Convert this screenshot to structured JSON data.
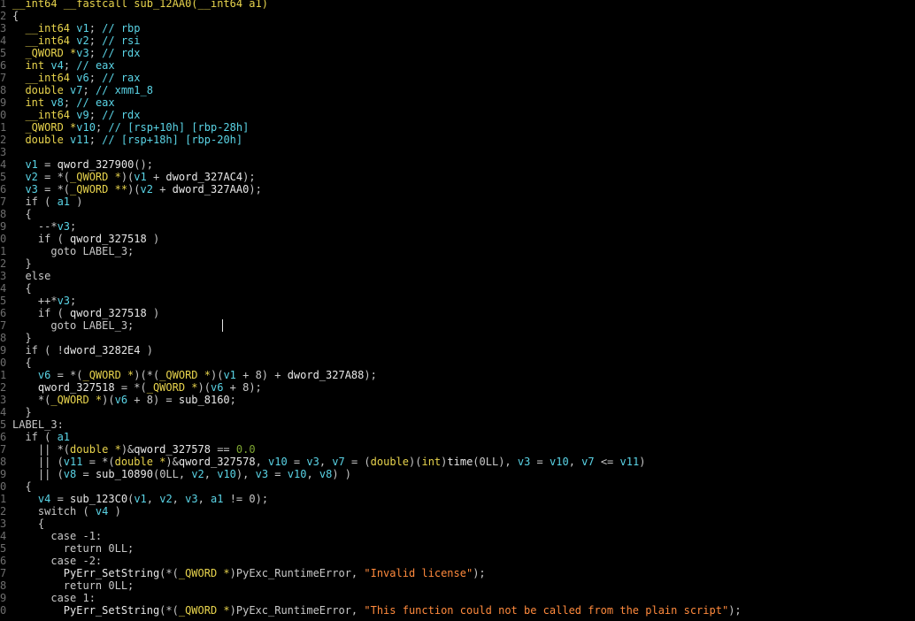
{
  "editor": {
    "lines": [
      {
        "n": "1",
        "toks": [
          {
            "t": "__int64 __fastcall sub_12AA0(__int64 a1)",
            "c": "t-type"
          }
        ]
      },
      {
        "n": "2",
        "toks": [
          {
            "t": "{",
            "c": "t-p"
          }
        ]
      },
      {
        "n": "3",
        "toks": [
          {
            "t": "  __int64 ",
            "c": "t-type"
          },
          {
            "t": "v1",
            "c": "t-var"
          },
          {
            "t": "; ",
            "c": "t-p"
          },
          {
            "t": "// rbp",
            "c": "t-cmt"
          }
        ]
      },
      {
        "n": "4",
        "toks": [
          {
            "t": "  __int64 ",
            "c": "t-type"
          },
          {
            "t": "v2",
            "c": "t-var"
          },
          {
            "t": "; ",
            "c": "t-p"
          },
          {
            "t": "// rsi",
            "c": "t-cmt"
          }
        ]
      },
      {
        "n": "5",
        "toks": [
          {
            "t": "  _QWORD *",
            "c": "t-type"
          },
          {
            "t": "v3",
            "c": "t-var"
          },
          {
            "t": "; ",
            "c": "t-p"
          },
          {
            "t": "// rdx",
            "c": "t-cmt"
          }
        ]
      },
      {
        "n": "6",
        "toks": [
          {
            "t": "  int ",
            "c": "t-type"
          },
          {
            "t": "v4",
            "c": "t-var"
          },
          {
            "t": "; ",
            "c": "t-p"
          },
          {
            "t": "// eax",
            "c": "t-cmt"
          }
        ]
      },
      {
        "n": "7",
        "toks": [
          {
            "t": "  __int64 ",
            "c": "t-type"
          },
          {
            "t": "v6",
            "c": "t-var"
          },
          {
            "t": "; ",
            "c": "t-p"
          },
          {
            "t": "// rax",
            "c": "t-cmt"
          }
        ]
      },
      {
        "n": "8",
        "toks": [
          {
            "t": "  double ",
            "c": "t-type"
          },
          {
            "t": "v7",
            "c": "t-var"
          },
          {
            "t": "; ",
            "c": "t-p"
          },
          {
            "t": "// xmm1_8",
            "c": "t-cmt"
          }
        ]
      },
      {
        "n": "9",
        "toks": [
          {
            "t": "  int ",
            "c": "t-type"
          },
          {
            "t": "v8",
            "c": "t-var"
          },
          {
            "t": "; ",
            "c": "t-p"
          },
          {
            "t": "// eax",
            "c": "t-cmt"
          }
        ]
      },
      {
        "n": "0",
        "toks": [
          {
            "t": "  __int64 ",
            "c": "t-type"
          },
          {
            "t": "v9",
            "c": "t-var"
          },
          {
            "t": "; ",
            "c": "t-p"
          },
          {
            "t": "// rdx",
            "c": "t-cmt"
          }
        ]
      },
      {
        "n": "1",
        "toks": [
          {
            "t": "  _QWORD *",
            "c": "t-type"
          },
          {
            "t": "v10",
            "c": "t-var"
          },
          {
            "t": "; ",
            "c": "t-p"
          },
          {
            "t": "// [rsp+10h] [rbp-28h]",
            "c": "t-cmt"
          }
        ]
      },
      {
        "n": "2",
        "toks": [
          {
            "t": "  double ",
            "c": "t-type"
          },
          {
            "t": "v11",
            "c": "t-var"
          },
          {
            "t": "; ",
            "c": "t-p"
          },
          {
            "t": "// [rsp+18h] [rbp-20h]",
            "c": "t-cmt"
          }
        ]
      },
      {
        "n": "3",
        "toks": []
      },
      {
        "n": "4",
        "toks": [
          {
            "t": "  v1",
            "c": "t-var"
          },
          {
            "t": " = ",
            "c": "t-p"
          },
          {
            "t": "qword_327900",
            "c": "t-fn"
          },
          {
            "t": "();",
            "c": "t-p"
          }
        ]
      },
      {
        "n": "5",
        "toks": [
          {
            "t": "  v2",
            "c": "t-var"
          },
          {
            "t": " = *(",
            "c": "t-p"
          },
          {
            "t": "_QWORD *",
            "c": "t-type"
          },
          {
            "t": ")(",
            "c": "t-p"
          },
          {
            "t": "v1",
            "c": "t-var"
          },
          {
            "t": " + ",
            "c": "t-p"
          },
          {
            "t": "dword_327AC4",
            "c": "t-fn"
          },
          {
            "t": ");",
            "c": "t-p"
          }
        ]
      },
      {
        "n": "6",
        "toks": [
          {
            "t": "  v3",
            "c": "t-var"
          },
          {
            "t": " = *(",
            "c": "t-p"
          },
          {
            "t": "_QWORD **",
            "c": "t-type"
          },
          {
            "t": ")(",
            "c": "t-p"
          },
          {
            "t": "v2",
            "c": "t-var"
          },
          {
            "t": " + ",
            "c": "t-p"
          },
          {
            "t": "dword_327AA0",
            "c": "t-fn"
          },
          {
            "t": ");",
            "c": "t-p"
          }
        ]
      },
      {
        "n": "7",
        "toks": [
          {
            "t": "  if ( ",
            "c": "t-kw"
          },
          {
            "t": "a1",
            "c": "t-var"
          },
          {
            "t": " )",
            "c": "t-p"
          }
        ]
      },
      {
        "n": "8",
        "toks": [
          {
            "t": "  {",
            "c": "t-p"
          }
        ]
      },
      {
        "n": "9",
        "toks": [
          {
            "t": "    --*",
            "c": "t-p"
          },
          {
            "t": "v3",
            "c": "t-var"
          },
          {
            "t": ";",
            "c": "t-p"
          }
        ]
      },
      {
        "n": "0",
        "toks": [
          {
            "t": "    if ( ",
            "c": "t-kw"
          },
          {
            "t": "qword_327518",
            "c": "t-fn"
          },
          {
            "t": " )",
            "c": "t-p"
          }
        ]
      },
      {
        "n": "1",
        "toks": [
          {
            "t": "      goto LABEL_3;",
            "c": "t-kw"
          }
        ]
      },
      {
        "n": "2",
        "toks": [
          {
            "t": "  }",
            "c": "t-p"
          }
        ]
      },
      {
        "n": "3",
        "toks": [
          {
            "t": "  else",
            "c": "t-kw"
          }
        ]
      },
      {
        "n": "4",
        "toks": [
          {
            "t": "  {",
            "c": "t-p"
          }
        ]
      },
      {
        "n": "5",
        "toks": [
          {
            "t": "    ++*",
            "c": "t-p"
          },
          {
            "t": "v3",
            "c": "t-var"
          },
          {
            "t": ";",
            "c": "t-p"
          }
        ]
      },
      {
        "n": "6",
        "toks": [
          {
            "t": "    if ( ",
            "c": "t-kw"
          },
          {
            "t": "qword_327518",
            "c": "t-fn"
          },
          {
            "t": " )",
            "c": "t-p"
          }
        ]
      },
      {
        "n": "7",
        "toks": [
          {
            "t": "      goto LABEL_3;",
            "c": "t-kw"
          }
        ]
      },
      {
        "n": "8",
        "toks": [
          {
            "t": "  }",
            "c": "t-p"
          }
        ]
      },
      {
        "n": "9",
        "toks": [
          {
            "t": "  if ( !",
            "c": "t-kw"
          },
          {
            "t": "dword_3282E4",
            "c": "t-fn"
          },
          {
            "t": " )",
            "c": "t-p"
          }
        ]
      },
      {
        "n": "0",
        "toks": [
          {
            "t": "  {",
            "c": "t-p"
          }
        ]
      },
      {
        "n": "1",
        "toks": [
          {
            "t": "    v6",
            "c": "t-var"
          },
          {
            "t": " = *(",
            "c": "t-p"
          },
          {
            "t": "_QWORD *",
            "c": "t-type"
          },
          {
            "t": ")(*(",
            "c": "t-p"
          },
          {
            "t": "_QWORD *",
            "c": "t-type"
          },
          {
            "t": ")(",
            "c": "t-p"
          },
          {
            "t": "v1",
            "c": "t-var"
          },
          {
            "t": " + 8) + ",
            "c": "t-p"
          },
          {
            "t": "dword_327A88",
            "c": "t-fn"
          },
          {
            "t": ");",
            "c": "t-p"
          }
        ]
      },
      {
        "n": "2",
        "toks": [
          {
            "t": "    qword_327518",
            "c": "t-fn"
          },
          {
            "t": " = *(",
            "c": "t-p"
          },
          {
            "t": "_QWORD *",
            "c": "t-type"
          },
          {
            "t": ")(",
            "c": "t-p"
          },
          {
            "t": "v6",
            "c": "t-var"
          },
          {
            "t": " + 8);",
            "c": "t-p"
          }
        ]
      },
      {
        "n": "3",
        "toks": [
          {
            "t": "    *(",
            "c": "t-p"
          },
          {
            "t": "_QWORD *",
            "c": "t-type"
          },
          {
            "t": ")(",
            "c": "t-p"
          },
          {
            "t": "v6",
            "c": "t-var"
          },
          {
            "t": " + 8) = ",
            "c": "t-p"
          },
          {
            "t": "sub_8160",
            "c": "t-fn"
          },
          {
            "t": ";",
            "c": "t-p"
          }
        ]
      },
      {
        "n": "4",
        "toks": [
          {
            "t": "  }",
            "c": "t-p"
          }
        ]
      },
      {
        "n": "5",
        "toks": [
          {
            "t": "LABEL_3:",
            "c": "t-lbl"
          }
        ]
      },
      {
        "n": "6",
        "toks": [
          {
            "t": "  if ( ",
            "c": "t-kw"
          },
          {
            "t": "a1",
            "c": "t-var"
          }
        ]
      },
      {
        "n": "7",
        "toks": [
          {
            "t": "    || *(",
            "c": "t-p"
          },
          {
            "t": "double *",
            "c": "t-type"
          },
          {
            "t": ")&",
            "c": "t-p"
          },
          {
            "t": "qword_327578",
            "c": "t-fn"
          },
          {
            "t": " == ",
            "c": "t-p"
          },
          {
            "t": "0.0",
            "c": "t-fl"
          }
        ]
      },
      {
        "n": "8",
        "toks": [
          {
            "t": "    || (",
            "c": "t-p"
          },
          {
            "t": "v11",
            "c": "t-var"
          },
          {
            "t": " = *(",
            "c": "t-p"
          },
          {
            "t": "double *",
            "c": "t-type"
          },
          {
            "t": ")&",
            "c": "t-p"
          },
          {
            "t": "qword_327578",
            "c": "t-fn"
          },
          {
            "t": ", ",
            "c": "t-p"
          },
          {
            "t": "v10",
            "c": "t-var"
          },
          {
            "t": " = ",
            "c": "t-p"
          },
          {
            "t": "v3",
            "c": "t-var"
          },
          {
            "t": ", ",
            "c": "t-p"
          },
          {
            "t": "v7",
            "c": "t-var"
          },
          {
            "t": " = (",
            "c": "t-p"
          },
          {
            "t": "double",
            "c": "t-type"
          },
          {
            "t": ")(",
            "c": "t-p"
          },
          {
            "t": "int",
            "c": "t-type"
          },
          {
            "t": ")",
            "c": "t-p"
          },
          {
            "t": "time",
            "c": "t-fn"
          },
          {
            "t": "(0LL), ",
            "c": "t-p"
          },
          {
            "t": "v3",
            "c": "t-var"
          },
          {
            "t": " = ",
            "c": "t-p"
          },
          {
            "t": "v10",
            "c": "t-var"
          },
          {
            "t": ", ",
            "c": "t-p"
          },
          {
            "t": "v7",
            "c": "t-var"
          },
          {
            "t": " <= ",
            "c": "t-p"
          },
          {
            "t": "v11",
            "c": "t-var"
          },
          {
            "t": ")",
            "c": "t-p"
          }
        ]
      },
      {
        "n": "9",
        "toks": [
          {
            "t": "    || (",
            "c": "t-p"
          },
          {
            "t": "v8",
            "c": "t-var"
          },
          {
            "t": " = ",
            "c": "t-p"
          },
          {
            "t": "sub_10890",
            "c": "t-fn"
          },
          {
            "t": "(0LL, ",
            "c": "t-p"
          },
          {
            "t": "v2",
            "c": "t-var"
          },
          {
            "t": ", ",
            "c": "t-p"
          },
          {
            "t": "v10",
            "c": "t-var"
          },
          {
            "t": "), ",
            "c": "t-p"
          },
          {
            "t": "v3",
            "c": "t-var"
          },
          {
            "t": " = ",
            "c": "t-p"
          },
          {
            "t": "v10",
            "c": "t-var"
          },
          {
            "t": ", ",
            "c": "t-p"
          },
          {
            "t": "v8",
            "c": "t-var"
          },
          {
            "t": ") )",
            "c": "t-p"
          }
        ]
      },
      {
        "n": "0",
        "toks": [
          {
            "t": "  {",
            "c": "t-p"
          }
        ]
      },
      {
        "n": "1",
        "toks": [
          {
            "t": "    v4",
            "c": "t-var"
          },
          {
            "t": " = ",
            "c": "t-p"
          },
          {
            "t": "sub_123C0",
            "c": "t-fn"
          },
          {
            "t": "(",
            "c": "t-p"
          },
          {
            "t": "v1",
            "c": "t-var"
          },
          {
            "t": ", ",
            "c": "t-p"
          },
          {
            "t": "v2",
            "c": "t-var"
          },
          {
            "t": ", ",
            "c": "t-p"
          },
          {
            "t": "v3",
            "c": "t-var"
          },
          {
            "t": ", ",
            "c": "t-p"
          },
          {
            "t": "a1",
            "c": "t-var"
          },
          {
            "t": " != 0);",
            "c": "t-p"
          }
        ]
      },
      {
        "n": "2",
        "toks": [
          {
            "t": "    switch ( ",
            "c": "t-kw"
          },
          {
            "t": "v4",
            "c": "t-var"
          },
          {
            "t": " )",
            "c": "t-p"
          }
        ]
      },
      {
        "n": "3",
        "toks": [
          {
            "t": "    {",
            "c": "t-p"
          }
        ]
      },
      {
        "n": "4",
        "toks": [
          {
            "t": "      case -1:",
            "c": "t-kw"
          }
        ]
      },
      {
        "n": "5",
        "toks": [
          {
            "t": "        return 0LL;",
            "c": "t-kw"
          }
        ]
      },
      {
        "n": "6",
        "toks": [
          {
            "t": "      case -2:",
            "c": "t-kw"
          }
        ]
      },
      {
        "n": "7",
        "toks": [
          {
            "t": "        PyErr_SetString",
            "c": "t-fn"
          },
          {
            "t": "(*(",
            "c": "t-p"
          },
          {
            "t": "_QWORD *",
            "c": "t-type"
          },
          {
            "t": ")PyExc_RuntimeError, ",
            "c": "t-p"
          },
          {
            "t": "\"Invalid license\"",
            "c": "t-str"
          },
          {
            "t": ");",
            "c": "t-p"
          }
        ]
      },
      {
        "n": "8",
        "toks": [
          {
            "t": "        return 0LL;",
            "c": "t-kw"
          }
        ]
      },
      {
        "n": "9",
        "toks": [
          {
            "t": "      case 1:",
            "c": "t-kw"
          }
        ]
      },
      {
        "n": "0",
        "toks": [
          {
            "t": "        PyErr_SetString",
            "c": "t-fn"
          },
          {
            "t": "(*(",
            "c": "t-p"
          },
          {
            "t": "_QWORD *",
            "c": "t-type"
          },
          {
            "t": ")PyExc_RuntimeError, ",
            "c": "t-p"
          },
          {
            "t": "\"This function could not be called from the plain script\"",
            "c": "t-str"
          },
          {
            "t": ");",
            "c": "t-p"
          }
        ]
      }
    ]
  }
}
